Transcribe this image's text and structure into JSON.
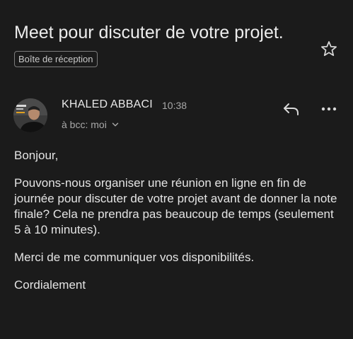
{
  "email": {
    "subject": "Meet pour discuter de votre projet.",
    "label": "Boîte de réception",
    "sender_name": "KHALED ABBACI",
    "time": "10:38",
    "recipients": "à bcc: moi",
    "body": {
      "greeting": "Bonjour,",
      "paragraph_1": "Pouvons-nous organiser une réunion en ligne en fin de journée pour discuter de votre projet avant de donner la note finale? Cela ne prendra pas beaucoup de temps (seulement 5 à 10 minutes).",
      "paragraph_2": "Merci de me communiquer vos disponibilités.",
      "closing": "Cordialement"
    }
  },
  "icons": {
    "star": "star-outline-icon",
    "reply": "reply-icon",
    "more": "more-horizontal-icon",
    "expand": "chevron-down-icon"
  },
  "colors": {
    "background": "#1b1b1b",
    "text_primary": "#e6e6e6",
    "text_secondary": "#a8a8a8"
  }
}
